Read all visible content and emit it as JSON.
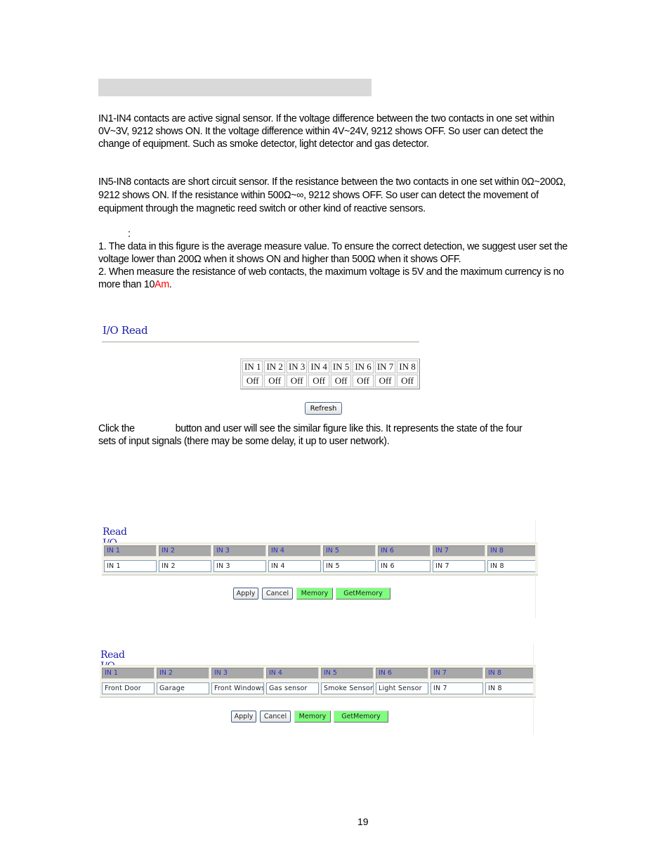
{
  "section_heading": "",
  "paragraphs": {
    "active_sensor": "IN1-IN4 contacts are active signal sensor. If the voltage difference between the two contacts in one set within 0V~3V, 9212 shows ON. It the voltage difference within 4V~24V, 9212 shows OFF. So user can detect the change of equipment. Such as smoke detector, light detector and gas detector.",
    "short_circuit_sensor": "IN5-IN8 contacts are short circuit sensor. If the resistance between the two contacts in one set within 0Ω~200Ω, 9212 shows ON. If the resistance within 500Ω~∞, 9212 shows OFF. So user can detect the movement of equipment through the magnetic reed switch or other kind of reactive sensors.",
    "note_colon": ":",
    "note_1": "1. The data in this figure is the average measure value. To ensure the correct detection, we suggest user set the voltage lower than 200Ω when it shows ON and higher than 500Ω when it shows OFF.",
    "note_2_prefix": "2. When measure the resistance of web contacts, the maximum voltage is 5V and the maximum currency is no more than 10",
    "note_2_red": "Am",
    "note_2_suffix": ".",
    "click_refresh_a": "Click the",
    "click_refresh_b": "button and user will see the similar figure like this. It represents the state of the four",
    "click_refresh_c": "sets of input signals (there may be some delay, it up to user network)."
  },
  "io_read": {
    "title": "I/O Read",
    "inputs": [
      "IN 1",
      "IN 2",
      "IN 3",
      "IN 4",
      "IN 5",
      "IN 6",
      "IN 7",
      "IN 8"
    ],
    "states": [
      "Off",
      "Off",
      "Off",
      "Off",
      "Off",
      "Off",
      "Off",
      "Off"
    ],
    "refresh_label": "Refresh"
  },
  "read_io_name_default": {
    "title": "Read I/O Name",
    "headers": [
      "IN 1",
      "IN 2",
      "IN 3",
      "IN 4",
      "IN 5",
      "IN 6",
      "IN 7",
      "IN 8"
    ],
    "values": [
      "IN 1",
      "IN 2",
      "IN 3",
      "IN 4",
      "IN 5",
      "IN 6",
      "IN 7",
      "IN 8"
    ],
    "buttons": {
      "apply": "Apply",
      "cancel": "Cancel",
      "memory": "Memory",
      "get_memory": "GetMemory"
    }
  },
  "read_io_name_custom": {
    "title": "Read I/O Name",
    "headers": [
      "IN 1",
      "IN 2",
      "IN 3",
      "IN 4",
      "IN 5",
      "IN 6",
      "IN 7",
      "IN 8"
    ],
    "values": [
      "Front Door",
      "Garage",
      "Front Windows",
      "Gas sensor",
      "Smoke Sensor",
      "Light Sensor",
      "IN 7",
      "IN 8"
    ],
    "buttons": {
      "apply": "Apply",
      "cancel": "Cancel",
      "memory": "Memory",
      "get_memory": "GetMemory"
    }
  },
  "colors": {
    "heading_bar": "#d9d9d9",
    "title_blue": "#1a1aa6",
    "header_text_blue": "#2a2ad0",
    "green_button": "#80ff80",
    "warning_red": "#ff0000"
  },
  "page_number": "19"
}
